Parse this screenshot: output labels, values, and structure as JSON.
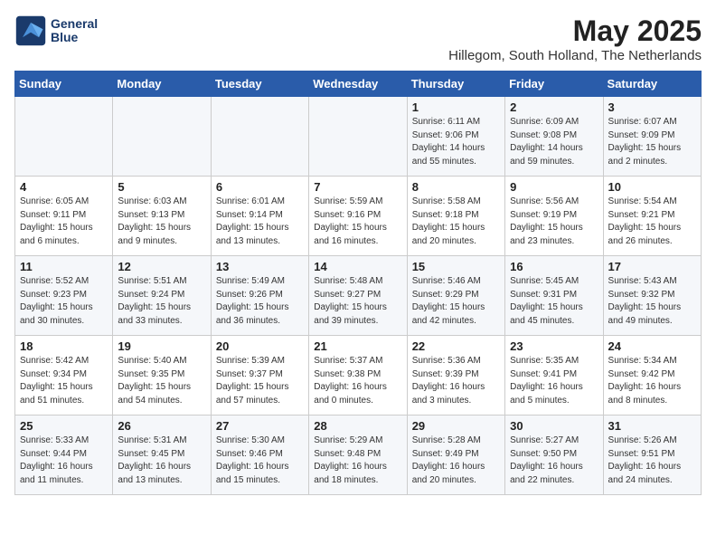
{
  "header": {
    "logo_line1": "General",
    "logo_line2": "Blue",
    "month": "May 2025",
    "location": "Hillegom, South Holland, The Netherlands"
  },
  "days_of_week": [
    "Sunday",
    "Monday",
    "Tuesday",
    "Wednesday",
    "Thursday",
    "Friday",
    "Saturday"
  ],
  "weeks": [
    [
      {
        "day": "",
        "info": ""
      },
      {
        "day": "",
        "info": ""
      },
      {
        "day": "",
        "info": ""
      },
      {
        "day": "",
        "info": ""
      },
      {
        "day": "1",
        "info": "Sunrise: 6:11 AM\nSunset: 9:06 PM\nDaylight: 14 hours\nand 55 minutes."
      },
      {
        "day": "2",
        "info": "Sunrise: 6:09 AM\nSunset: 9:08 PM\nDaylight: 14 hours\nand 59 minutes."
      },
      {
        "day": "3",
        "info": "Sunrise: 6:07 AM\nSunset: 9:09 PM\nDaylight: 15 hours\nand 2 minutes."
      }
    ],
    [
      {
        "day": "4",
        "info": "Sunrise: 6:05 AM\nSunset: 9:11 PM\nDaylight: 15 hours\nand 6 minutes."
      },
      {
        "day": "5",
        "info": "Sunrise: 6:03 AM\nSunset: 9:13 PM\nDaylight: 15 hours\nand 9 minutes."
      },
      {
        "day": "6",
        "info": "Sunrise: 6:01 AM\nSunset: 9:14 PM\nDaylight: 15 hours\nand 13 minutes."
      },
      {
        "day": "7",
        "info": "Sunrise: 5:59 AM\nSunset: 9:16 PM\nDaylight: 15 hours\nand 16 minutes."
      },
      {
        "day": "8",
        "info": "Sunrise: 5:58 AM\nSunset: 9:18 PM\nDaylight: 15 hours\nand 20 minutes."
      },
      {
        "day": "9",
        "info": "Sunrise: 5:56 AM\nSunset: 9:19 PM\nDaylight: 15 hours\nand 23 minutes."
      },
      {
        "day": "10",
        "info": "Sunrise: 5:54 AM\nSunset: 9:21 PM\nDaylight: 15 hours\nand 26 minutes."
      }
    ],
    [
      {
        "day": "11",
        "info": "Sunrise: 5:52 AM\nSunset: 9:23 PM\nDaylight: 15 hours\nand 30 minutes."
      },
      {
        "day": "12",
        "info": "Sunrise: 5:51 AM\nSunset: 9:24 PM\nDaylight: 15 hours\nand 33 minutes."
      },
      {
        "day": "13",
        "info": "Sunrise: 5:49 AM\nSunset: 9:26 PM\nDaylight: 15 hours\nand 36 minutes."
      },
      {
        "day": "14",
        "info": "Sunrise: 5:48 AM\nSunset: 9:27 PM\nDaylight: 15 hours\nand 39 minutes."
      },
      {
        "day": "15",
        "info": "Sunrise: 5:46 AM\nSunset: 9:29 PM\nDaylight: 15 hours\nand 42 minutes."
      },
      {
        "day": "16",
        "info": "Sunrise: 5:45 AM\nSunset: 9:31 PM\nDaylight: 15 hours\nand 45 minutes."
      },
      {
        "day": "17",
        "info": "Sunrise: 5:43 AM\nSunset: 9:32 PM\nDaylight: 15 hours\nand 49 minutes."
      }
    ],
    [
      {
        "day": "18",
        "info": "Sunrise: 5:42 AM\nSunset: 9:34 PM\nDaylight: 15 hours\nand 51 minutes."
      },
      {
        "day": "19",
        "info": "Sunrise: 5:40 AM\nSunset: 9:35 PM\nDaylight: 15 hours\nand 54 minutes."
      },
      {
        "day": "20",
        "info": "Sunrise: 5:39 AM\nSunset: 9:37 PM\nDaylight: 15 hours\nand 57 minutes."
      },
      {
        "day": "21",
        "info": "Sunrise: 5:37 AM\nSunset: 9:38 PM\nDaylight: 16 hours\nand 0 minutes."
      },
      {
        "day": "22",
        "info": "Sunrise: 5:36 AM\nSunset: 9:39 PM\nDaylight: 16 hours\nand 3 minutes."
      },
      {
        "day": "23",
        "info": "Sunrise: 5:35 AM\nSunset: 9:41 PM\nDaylight: 16 hours\nand 5 minutes."
      },
      {
        "day": "24",
        "info": "Sunrise: 5:34 AM\nSunset: 9:42 PM\nDaylight: 16 hours\nand 8 minutes."
      }
    ],
    [
      {
        "day": "25",
        "info": "Sunrise: 5:33 AM\nSunset: 9:44 PM\nDaylight: 16 hours\nand 11 minutes."
      },
      {
        "day": "26",
        "info": "Sunrise: 5:31 AM\nSunset: 9:45 PM\nDaylight: 16 hours\nand 13 minutes."
      },
      {
        "day": "27",
        "info": "Sunrise: 5:30 AM\nSunset: 9:46 PM\nDaylight: 16 hours\nand 15 minutes."
      },
      {
        "day": "28",
        "info": "Sunrise: 5:29 AM\nSunset: 9:48 PM\nDaylight: 16 hours\nand 18 minutes."
      },
      {
        "day": "29",
        "info": "Sunrise: 5:28 AM\nSunset: 9:49 PM\nDaylight: 16 hours\nand 20 minutes."
      },
      {
        "day": "30",
        "info": "Sunrise: 5:27 AM\nSunset: 9:50 PM\nDaylight: 16 hours\nand 22 minutes."
      },
      {
        "day": "31",
        "info": "Sunrise: 5:26 AM\nSunset: 9:51 PM\nDaylight: 16 hours\nand 24 minutes."
      }
    ]
  ]
}
